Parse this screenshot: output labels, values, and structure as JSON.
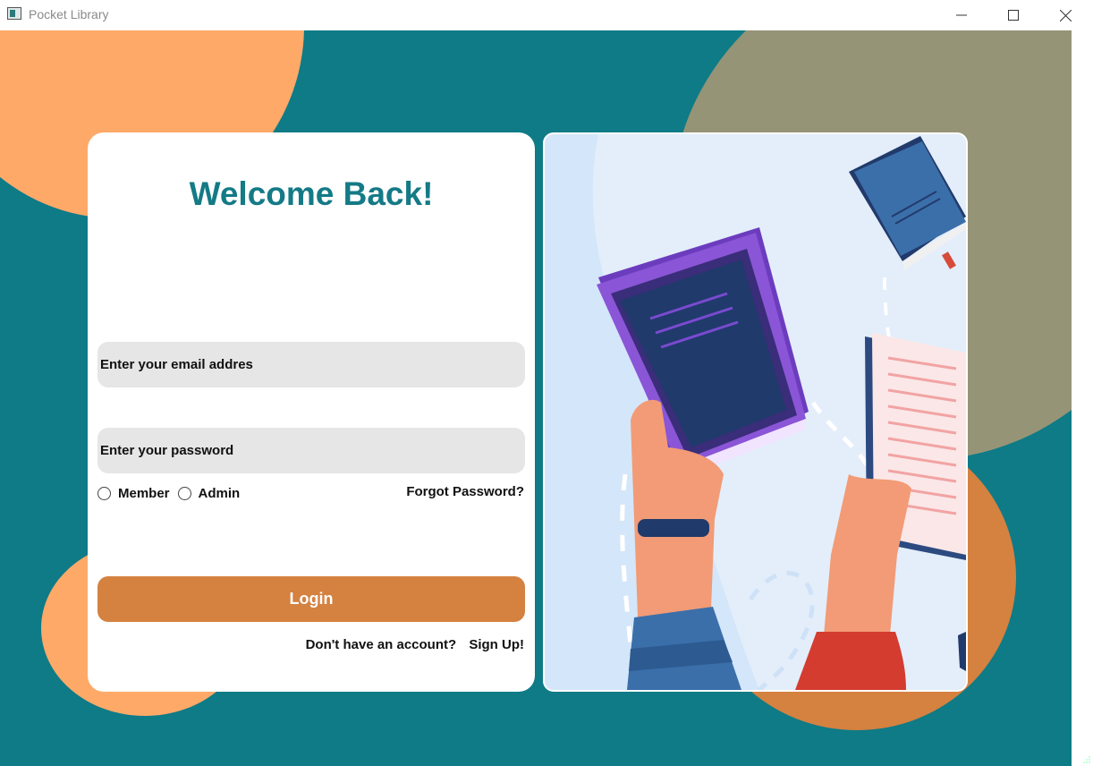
{
  "window": {
    "title": "Pocket Library",
    "controls": [
      "minimize",
      "maximize",
      "close"
    ]
  },
  "login": {
    "heading": "Welcome Back!",
    "email_placeholder": "Enter your email addres",
    "password_placeholder": "Enter your password",
    "roles": [
      {
        "label": "Member",
        "selected": false
      },
      {
        "label": "Admin",
        "selected": false
      }
    ],
    "forgot_label": "Forgot Password?",
    "login_label": "Login",
    "no_account_text": "Don't have an account?",
    "signup_label": "Sign Up!"
  },
  "colors": {
    "background": "#0e7b87",
    "heading": "#147a86",
    "login_button": "#d58140",
    "field": "#e6e6e6",
    "blob_peach": "#ffa968",
    "blob_olive": "#969476",
    "blob_orange": "#d58140"
  },
  "illustration": {
    "subject": "hands holding books",
    "icons": [
      "book-icon",
      "open-book-icon",
      "hand-icon",
      "wristband-icon"
    ]
  }
}
